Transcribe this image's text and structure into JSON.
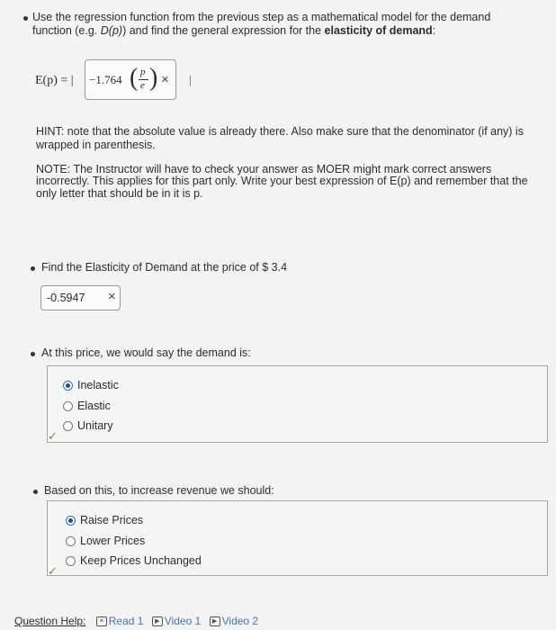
{
  "intro": {
    "line1": "Use the regression function from the previous step as a mathematical model for the demand",
    "line2_a": "function (e.g. ",
    "line2_b": "D(p)",
    "line2_c": ") and find the general expression for the ",
    "line2_d": "elasticity of demand",
    "line2_e": ":"
  },
  "formula": {
    "lhs": "E(p) = |",
    "coef": "−1.764",
    "numerator": "p",
    "denominator": "e",
    "close_bar": "|",
    "mark": "×"
  },
  "hint": {
    "label": "HINT",
    "line1": ": note that the absolute value is already there. Also make sure that the denominator (if any) is",
    "line2": "wrapped in parenthesis."
  },
  "note": {
    "label": "NOTE",
    "line1": ": The Instructor will have to check your answer as MOER might mark correct answers",
    "line2": "incorrectly. This applies for this part only. Write your best expression of E(p) and remember that the",
    "line3": "only letter that should be in it is p."
  },
  "q_elasticity": {
    "prompt": "Find the Elasticity of Demand at the price of $ 3.4",
    "answer": "-0.5947",
    "mark": "×"
  },
  "q_demand": {
    "prompt": "At this price, we would say the demand is:",
    "options": [
      "Inelastic",
      "Elastic",
      "Unitary"
    ],
    "selected": 0,
    "check": "✓"
  },
  "q_revenue": {
    "prompt": "Based on this, to increase revenue we should:",
    "options": [
      "Raise Prices",
      "Lower Prices",
      "Keep Prices Unchanged"
    ],
    "selected": 0,
    "check": "✓"
  },
  "help": {
    "label": "Question Help:",
    "read": "Read 1",
    "video1": "Video 1",
    "video2": "Video 2"
  }
}
